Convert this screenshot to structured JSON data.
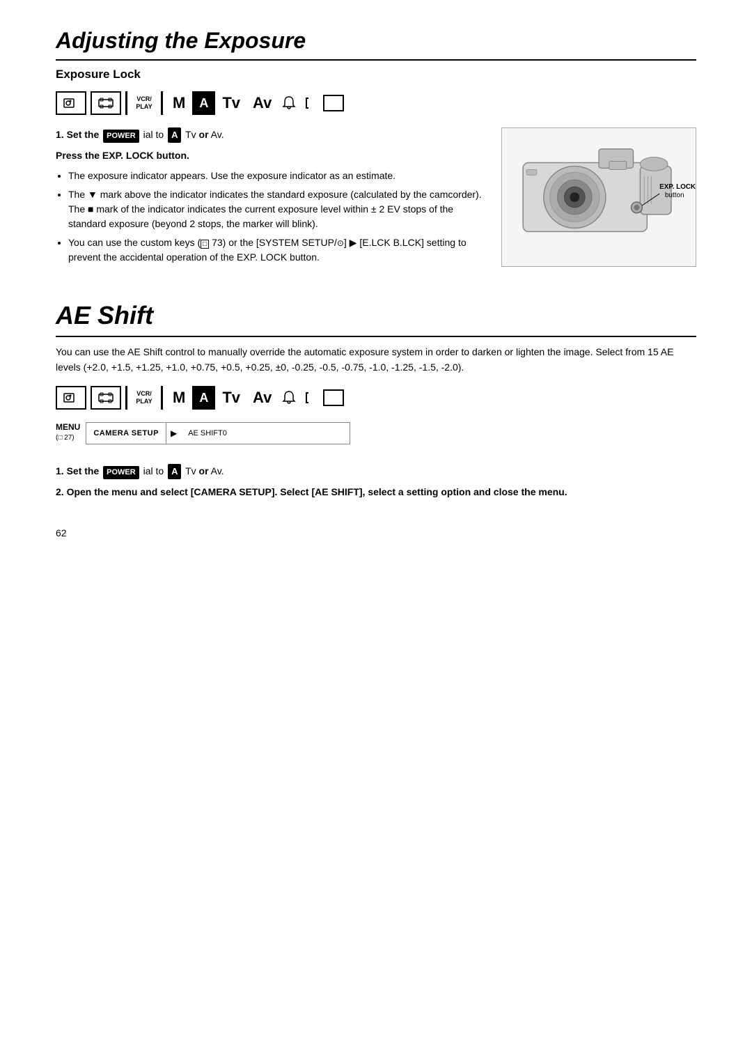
{
  "page": {
    "number": "62",
    "title": "Adjusting the Exposure"
  },
  "section1": {
    "title": "Exposure Lock",
    "modes": {
      "record_icon": "⊙",
      "film_icon": "▭",
      "vcr_play": "VCR/\nPLAY",
      "m_label": "M",
      "a_label": "A",
      "tv_label": "Tv",
      "av_label": "Av",
      "bell_icon": "🔔",
      "bracket_icon": "⌐",
      "square_icon": "□"
    },
    "step1": {
      "text_before": "Set the",
      "power_label": "POWER",
      "text_after": "ial to",
      "mode_label": "A",
      "suffix": "Tv or Av."
    },
    "step2": {
      "text": "Press the EXP. LOCK button."
    },
    "bullets": [
      "The exposure indicator appears. Use the exposure indicator as an estimate.",
      "The ▼ mark above the indicator indicates the standard exposure (calculated by the camcorder). The ■ mark of the indicator indicates the current exposure level within ± 2 EV stops of the standard exposure (beyond 2 stops, the marker will blink).",
      "You can use the custom keys (□ 73) or the [SYSTEM SETUP/⊙] ▶ [E.LCK B.LCK] setting to prevent the accidental operation of the EXP. LOCK button."
    ],
    "camera_label_line1": "EXP. LOCK",
    "camera_label_line2": "button"
  },
  "section2": {
    "title": "AE Shift",
    "body": "You can use the AE Shift control to manually override the automatic exposure system in order to darken or lighten the image. Select from 15 AE levels (+2.0, +1.5, +1.25, +1.0, +0.75, +0.5, +0.25, ±0, -0.25, -0.5, -0.75, -1.0, -1.25, -1.5, -2.0).",
    "menu": {
      "label": "MENU",
      "ref": "(□ 27)",
      "item": "CAMERA SETUP",
      "result": "AE SHIFT0"
    },
    "step1": {
      "text_before": "Set the",
      "power_label": "POWER",
      "text_after": "ial to",
      "mode_label": "A",
      "suffix": "Tv or Av."
    },
    "step2": {
      "text": "Open the menu and select [CAMERA SETUP]. Select [AE SHIFT], select a setting option and close the menu."
    }
  }
}
